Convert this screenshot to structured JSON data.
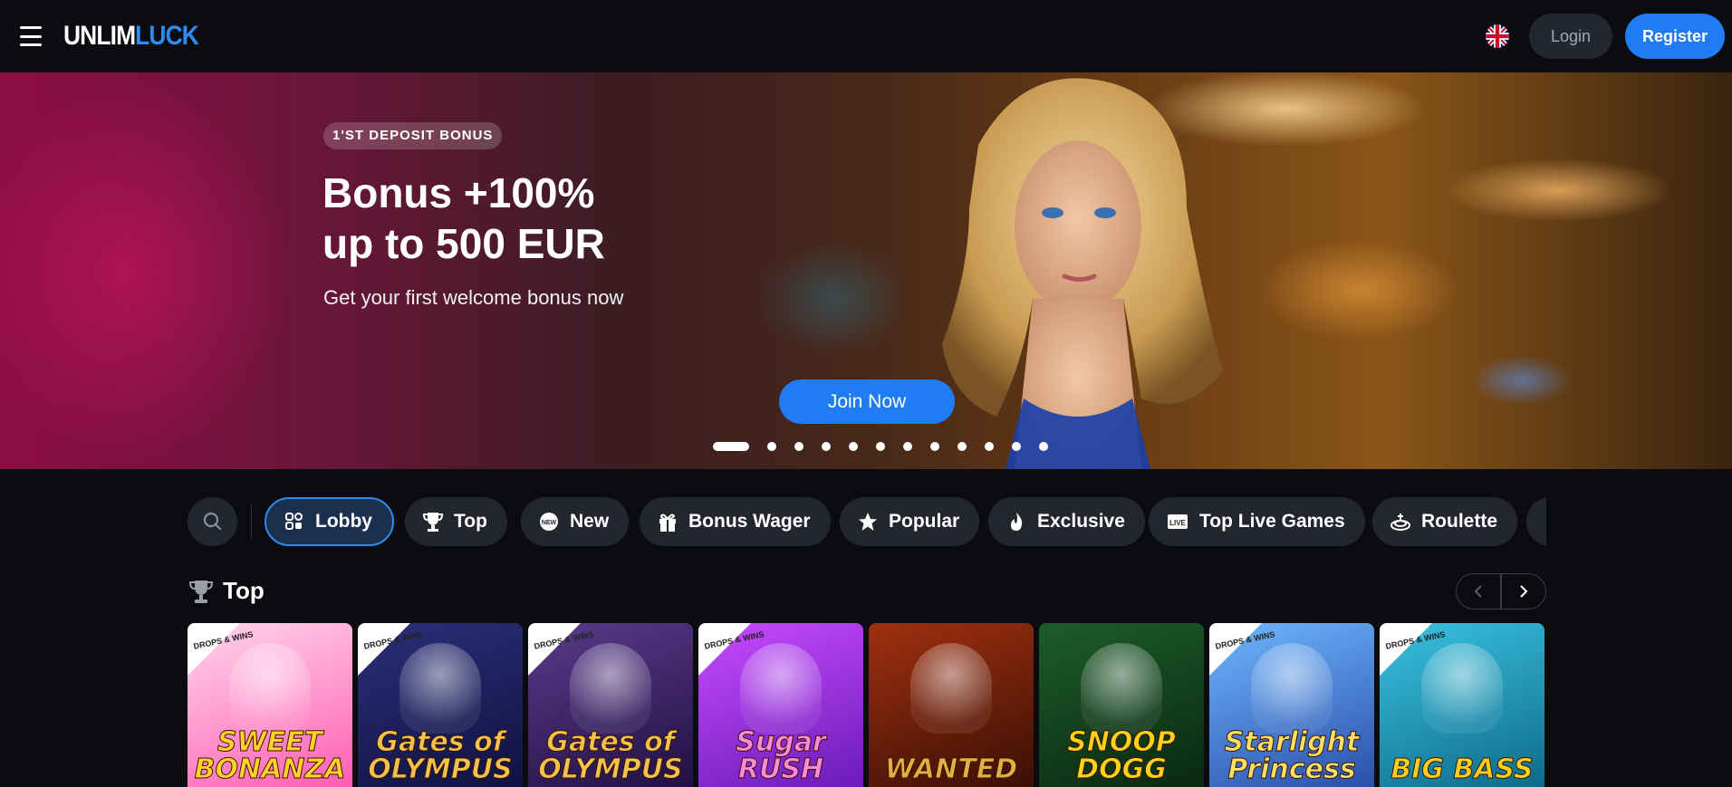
{
  "header": {
    "logo_white": "UNLIM",
    "logo_blue": "LUCK",
    "language_icon": "uk-flag-icon",
    "login_label": "Login",
    "register_label": "Register"
  },
  "hero": {
    "badge": "1'ST DEPOSIT BONUS",
    "title_line1": "Bonus +100%",
    "title_line2": "up to 500 EUR",
    "subtitle": "Get your first welcome bonus now",
    "cta_label": "Join Now",
    "slide_count": 12,
    "active_slide": 1
  },
  "categories": [
    {
      "label": "Lobby",
      "icon": "lobby-icon",
      "active": true
    },
    {
      "label": "Top",
      "icon": "trophy-icon",
      "active": false
    },
    {
      "label": "New",
      "icon": "new-badge-icon",
      "active": false
    },
    {
      "label": "Bonus Wager",
      "icon": "gift-icon",
      "active": false
    },
    {
      "label": "Popular",
      "icon": "star-icon",
      "active": false
    },
    {
      "label": "Exclusive",
      "icon": "flame-icon",
      "active": false
    },
    {
      "label": "Top Live Games",
      "icon": "live-icon",
      "active": false
    },
    {
      "label": "Roulette",
      "icon": "roulette-icon",
      "active": false
    }
  ],
  "section": {
    "title": "Top",
    "icon": "trophy-icon"
  },
  "games": [
    {
      "title": "SWEET BONANZA",
      "badge": "DROPS & WINS",
      "colors": [
        "#ffd6ec",
        "#ff5db1"
      ],
      "text_color": "#ffd12a"
    },
    {
      "title": "Gates of OLYMPUS",
      "badge": "DROPS & WINS",
      "colors": [
        "#2c2f7a",
        "#0f1240"
      ],
      "text_color": "#f2c14e"
    },
    {
      "title": "Gates of OLYMPUS",
      "badge": "DROPS & WINS",
      "colors": [
        "#5a3b8a",
        "#221044"
      ],
      "text_color": "#f2c14e"
    },
    {
      "title": "Sugar RUSH",
      "badge": "DROPS & WINS",
      "colors": [
        "#c84bff",
        "#6a1cb8"
      ],
      "text_color": "#ff8ad8"
    },
    {
      "title": "WANTED",
      "badge": "",
      "colors": [
        "#a0300f",
        "#3a0f05"
      ],
      "text_color": "#e0b040"
    },
    {
      "title": "SNOOP DOGG",
      "badge": "",
      "colors": [
        "#1d5c2a",
        "#0a2810"
      ],
      "text_color": "#ffd21a"
    },
    {
      "title": "Starlight Princess",
      "badge": "DROPS & WINS",
      "colors": [
        "#6fb7ff",
        "#2a4fa8"
      ],
      "text_color": "#ffe066"
    },
    {
      "title": "BIG BASS",
      "badge": "DROPS & WINS",
      "colors": [
        "#3ac2e0",
        "#0e6b8a"
      ],
      "text_color": "#ffcf1f"
    }
  ],
  "colors": {
    "accent": "#1f7cf2",
    "background": "#0b0c10",
    "chip": "#24262d"
  }
}
